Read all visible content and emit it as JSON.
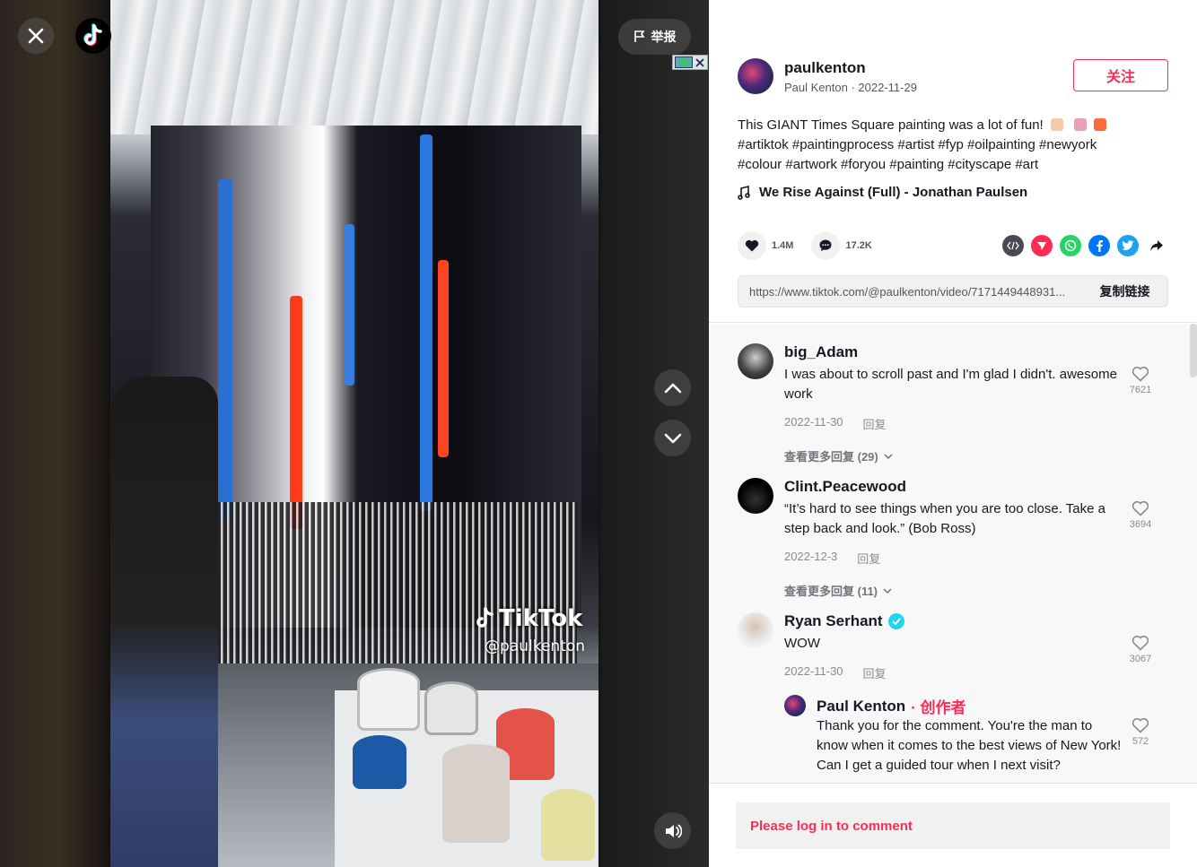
{
  "video": {
    "watermark_brand": "TikTok",
    "watermark_handle": "@paulkenton",
    "report_label": "举报"
  },
  "author": {
    "username": "paulkenton",
    "display_name": "Paul Kenton",
    "date": "2022-11-29",
    "follow_label": "关注"
  },
  "post": {
    "caption": "This GIANT Times Square painting was a lot of fun!",
    "hashtags_line1": "#artiktok #paintingprocess #artist #fyp #oilpainting #newyork",
    "hashtags_line2": "#colour #artwork #foryou #painting #cityscape #art",
    "music": "We Rise Against (Full) - Jonathan Paulsen",
    "likes": "1.4M",
    "comments": "17.2K",
    "link": "https://www.tiktok.com/@paulkenton/video/7171449448931...",
    "copy_label": "复制链接"
  },
  "comments": [
    {
      "user": "big_Adam",
      "text": "I was about to scroll past and I'm glad I didn't. awesome work",
      "date": "2022-11-30",
      "reply_label": "回复",
      "likes": "7621",
      "more": "查看更多回复 (29)"
    },
    {
      "user": "Clint.Peacewood",
      "text": "“It’s hard to see things when you are too close. Take a step back and look.” (Bob Ross)",
      "date": "2022-12-3",
      "reply_label": "回复",
      "likes": "3694",
      "more": "查看更多回复 (11)"
    },
    {
      "user": "Ryan Serhant",
      "text": "WOW",
      "date": "2022-11-30",
      "reply_label": "回复",
      "likes": "3067"
    },
    {
      "user": "Paul Kenton",
      "creator_tag": " · 创作者",
      "text": "Thank you for the comment. You're the man to know when it comes to the best views of New York! Can I get a guided tour when I next visit?",
      "likes": "572"
    }
  ],
  "footer": {
    "login_prompt": "Please log in to comment"
  },
  "colors": {
    "accent": "#fe2c55",
    "verified": "#20d5ec"
  }
}
